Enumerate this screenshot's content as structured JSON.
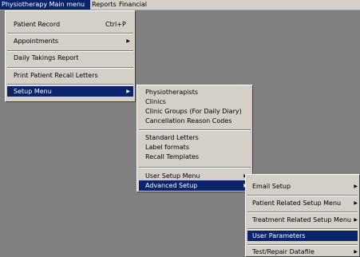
{
  "menubar": {
    "items": [
      {
        "label": "Physiotherapy Main menu"
      },
      {
        "label": "Reports"
      },
      {
        "label": "Financial"
      }
    ]
  },
  "main_menu": {
    "patient_record": {
      "label": "Patient Record",
      "shortcut": "Ctrl+P"
    },
    "appointments": {
      "label": "Appointments"
    },
    "daily_takings": {
      "label": "Daily Takings Report"
    },
    "print_recall": {
      "label": "Print Patient Recall Letters"
    },
    "setup_menu": {
      "label": "Setup Menu"
    }
  },
  "setup_menu": {
    "physiotherapists": {
      "label": "Physiotherapists"
    },
    "clinics": {
      "label": "Clinics"
    },
    "clinic_groups": {
      "label": "Clinic Groups (For Daily Diary)"
    },
    "cancellation_codes": {
      "label": "Cancellation Reason Codes"
    },
    "standard_letters": {
      "label": "Standard Letters"
    },
    "label_formats": {
      "label": "Label formats"
    },
    "recall_templates": {
      "label": "Recall Templates"
    },
    "user_setup": {
      "label": "User Setup Menu"
    },
    "advanced_setup": {
      "label": "Advanced Setup"
    }
  },
  "advanced_menu": {
    "email_setup": {
      "label": "Email  Setup"
    },
    "patient_related": {
      "label": "Patient Related Setup Menu"
    },
    "treatment_related": {
      "label": "Treatment Related Setup Menu"
    },
    "user_parameters": {
      "label": "User Parameters"
    },
    "test_repair": {
      "label": "Test/Repair Datafile"
    }
  },
  "icons": {
    "submenu_arrow": "triangle-right"
  }
}
